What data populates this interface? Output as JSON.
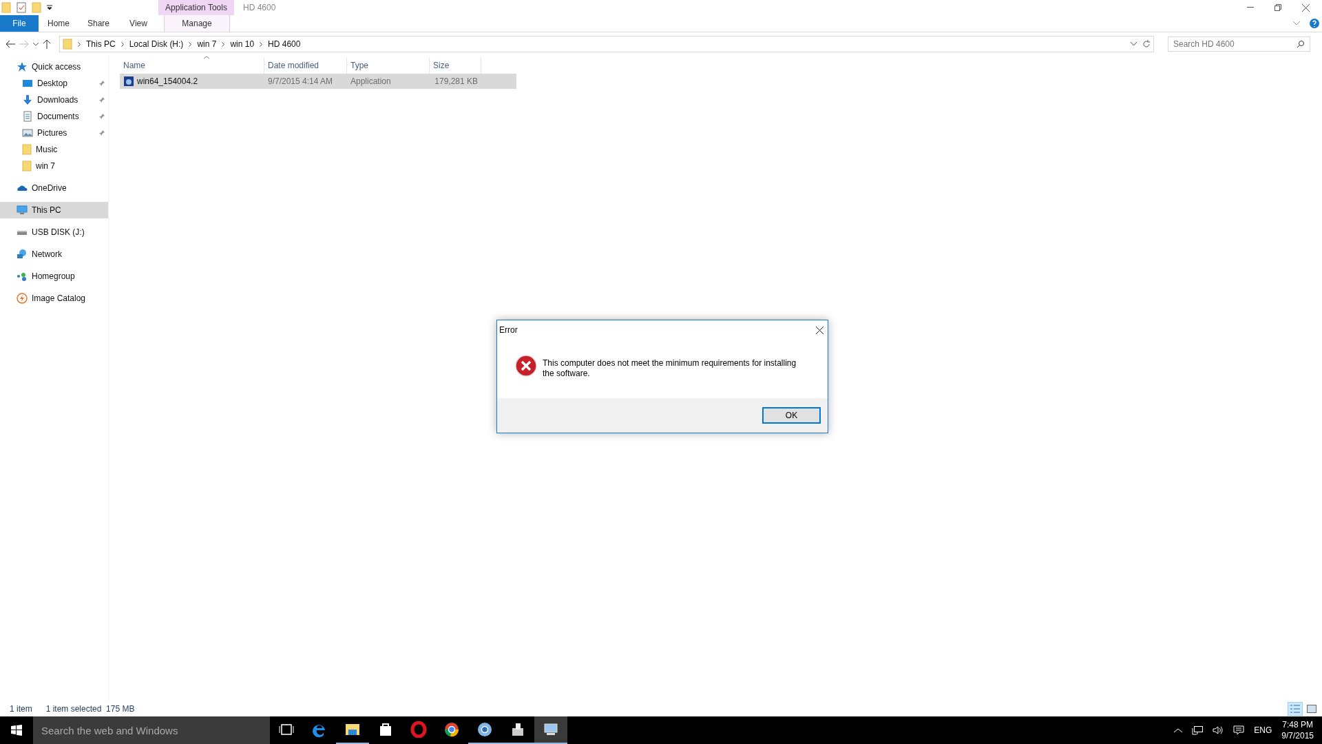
{
  "title_bar": {
    "context_tab": "Application Tools",
    "title": "HD 4600"
  },
  "ribbon_tabs": [
    {
      "label": "File",
      "kind": "file"
    },
    {
      "label": "Home",
      "kind": "tab"
    },
    {
      "label": "Share",
      "kind": "tab"
    },
    {
      "label": "View",
      "kind": "tab"
    },
    {
      "label": "Manage",
      "kind": "context"
    }
  ],
  "address_bar": {
    "crumbs": [
      "This PC",
      "Local Disk (H:)",
      "win 7",
      "win 10",
      "HD 4600"
    ]
  },
  "search": {
    "placeholder": "Search HD 4600"
  },
  "sidebar": {
    "items": [
      {
        "label": "Quick access",
        "kind": "star",
        "selected": false,
        "children": [
          {
            "label": "Desktop",
            "kind": "desktop",
            "pinned": true,
            "selected": false
          },
          {
            "label": "Downloads",
            "kind": "download",
            "pinned": true,
            "selected": false
          },
          {
            "label": "Documents",
            "kind": "document",
            "pinned": true,
            "selected": false
          },
          {
            "label": "Pictures",
            "kind": "picture",
            "pinned": true,
            "selected": false
          },
          {
            "label": "Music",
            "kind": "folder",
            "pinned": false,
            "selected": false
          },
          {
            "label": "win 7",
            "kind": "folder",
            "pinned": false,
            "selected": false
          }
        ]
      },
      {
        "label": "OneDrive",
        "kind": "cloud",
        "selected": false
      },
      {
        "label": "This PC",
        "kind": "pc",
        "selected": true
      },
      {
        "label": "USB DISK (J:)",
        "kind": "drive",
        "selected": false
      },
      {
        "label": "Network",
        "kind": "network",
        "selected": false
      },
      {
        "label": "Homegroup",
        "kind": "homegroup",
        "selected": false
      },
      {
        "label": "Image Catalog",
        "kind": "catalog",
        "selected": false
      }
    ]
  },
  "table": {
    "columns": [
      "Name",
      "Date modified",
      "Type",
      "Size"
    ],
    "rows": [
      {
        "name": "win64_154004.2",
        "date_modified": "9/7/2015 4:14 AM",
        "type": "Application",
        "size": "179,281 KB",
        "selected": true
      }
    ]
  },
  "status_bar": {
    "count": "1 item",
    "selection": "1 item selected  175 MB",
    "views": [
      {
        "kind": "details",
        "selected": true
      },
      {
        "kind": "large",
        "selected": false
      }
    ]
  },
  "dialog": {
    "title": "Error",
    "message": "This computer does not meet the minimum requirements for installing the software.",
    "button": "OK"
  },
  "taskbar": {
    "search_placeholder": "Search the web and Windows",
    "apps": [
      {
        "kind": "taskview",
        "running": false,
        "active": false
      },
      {
        "kind": "edge",
        "running": false,
        "active": false
      },
      {
        "kind": "explorer",
        "running": true,
        "active": false
      },
      {
        "kind": "store",
        "running": false,
        "active": false
      },
      {
        "kind": "opera",
        "running": false,
        "active": false
      },
      {
        "kind": "chrome",
        "running": false,
        "active": false
      },
      {
        "kind": "chromium",
        "running": true,
        "active": false
      },
      {
        "kind": "installer",
        "running": true,
        "active": false
      },
      {
        "kind": "monitor",
        "running": true,
        "active": true
      }
    ],
    "language": "ENG",
    "time": "7:48 PM",
    "date": "9/7/2015"
  }
}
